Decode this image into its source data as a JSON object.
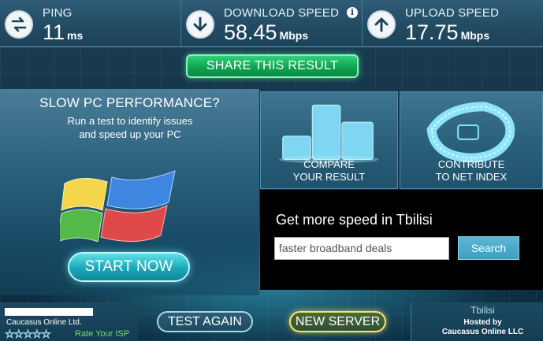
{
  "stats": {
    "ping": {
      "label": "PING",
      "value": "11",
      "unit": "ms",
      "icon": "exchange-arrows-icon"
    },
    "download": {
      "label": "DOWNLOAD SPEED",
      "value": "58.45",
      "unit": "Mbps",
      "icon": "down-arrow-icon",
      "info": "i"
    },
    "upload": {
      "label": "UPLOAD SPEED",
      "value": "17.75",
      "unit": "Mbps",
      "icon": "up-arrow-icon"
    }
  },
  "share": {
    "label": "SHARE THIS RESULT"
  },
  "promo": {
    "title": "SLOW PC PERFORMANCE?",
    "line1": "Run a test to identify issues",
    "line2": "and speed up your PC",
    "button": "START NOW"
  },
  "tiles": {
    "compare": {
      "line1": "COMPARE",
      "line2": "YOUR RESULT"
    },
    "contribute": {
      "line1": "CONTRIBUTE",
      "line2": "TO NET INDEX"
    }
  },
  "ad": {
    "title": "Get more speed in Tbilisi",
    "input_value": "faster broadband deals",
    "search_label": "Search"
  },
  "isp": {
    "name": "Caucasus Online Ltd.",
    "stars": "☆☆☆☆☆",
    "rate_label": "Rate Your ISP"
  },
  "bottom": {
    "test_again": "TEST AGAIN",
    "new_server": "NEW SERVER"
  },
  "server": {
    "city": "Tbilisi",
    "hosted_by": "Hosted by",
    "host": "Caucasus Online LLC"
  },
  "colors": {
    "accent_green": "#10a354",
    "accent_cyan": "#1aa8b9",
    "accent_yellow": "#ffe46b",
    "panel_blue": "#2a5f7a"
  }
}
